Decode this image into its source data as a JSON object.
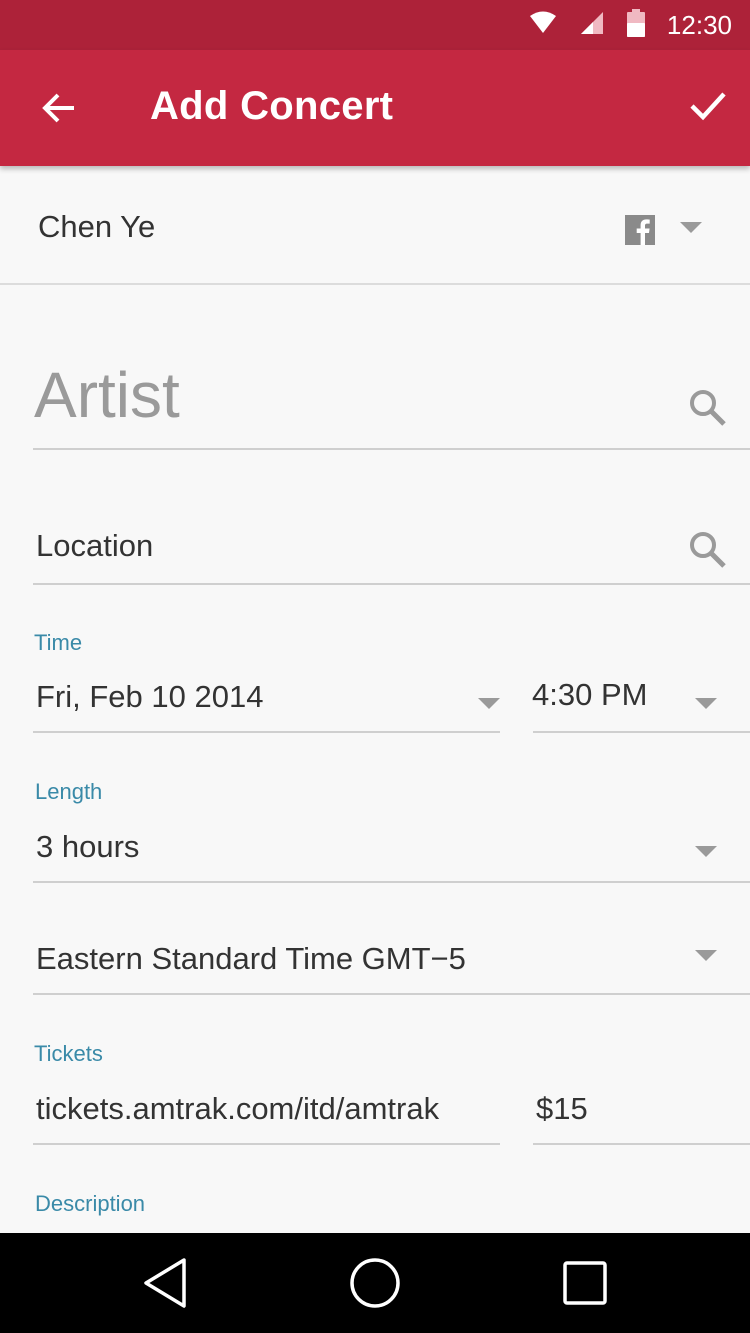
{
  "status_bar": {
    "time": "12:30",
    "icons": [
      "wifi-icon",
      "signal-icon",
      "battery-icon"
    ]
  },
  "app_bar": {
    "title": "Add Concert",
    "back_icon": "arrow-back-icon",
    "confirm_icon": "check-icon"
  },
  "account": {
    "name": "Chen Ye",
    "icon": "facebook-icon"
  },
  "artist": {
    "placeholder": "Artist"
  },
  "location": {
    "placeholder": "Location"
  },
  "time": {
    "label": "Time",
    "date": "Fri, Feb 10 2014",
    "time": "4:30 PM"
  },
  "length": {
    "label": "Length",
    "value": "3 hours"
  },
  "timezone": {
    "value": "Eastern Standard Time  GMT−5"
  },
  "tickets": {
    "label": "Tickets",
    "url": "tickets.amtrak.com/itd/amtrak",
    "price": "$15"
  },
  "description": {
    "label": "Description"
  },
  "nav": {
    "icons": [
      "back-icon",
      "home-icon",
      "recents-icon"
    ]
  },
  "colors": {
    "primary": "#c42841",
    "primary_dark": "#ad2239",
    "accent_label": "#3a8aa8"
  }
}
